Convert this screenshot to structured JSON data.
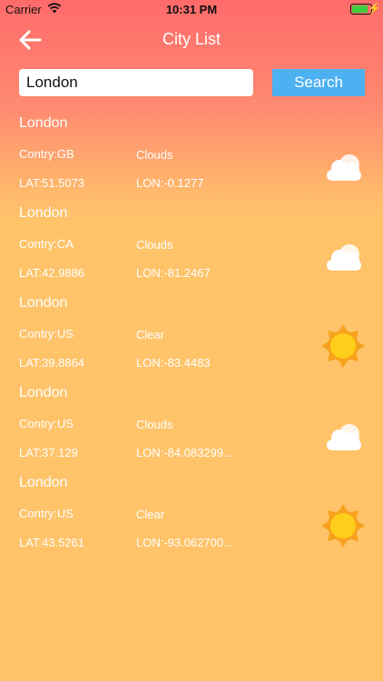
{
  "status_bar": {
    "carrier": "Carrier",
    "time": "10:31 PM",
    "battery_level": 0.9
  },
  "nav": {
    "title": "City List"
  },
  "search": {
    "value": "London",
    "placeholder": "",
    "button_label": "Search"
  },
  "cities": [
    {
      "name": "London",
      "country": "Contry:GB",
      "weather": "Clouds",
      "icon": "cloud-icon",
      "lat": "LAT:51.5073",
      "lon": "LON:-0.1277"
    },
    {
      "name": "London",
      "country": "Contry:CA",
      "weather": "Clouds",
      "icon": "cloud-icon",
      "lat": "LAT:42.9886",
      "lon": "LON:-81.2467"
    },
    {
      "name": "London",
      "country": "Contry:US",
      "weather": "Clear",
      "icon": "sun-icon",
      "lat": "LAT:39.8864",
      "lon": "LON:-83.4483"
    },
    {
      "name": "London",
      "country": "Contry:US",
      "weather": "Clouds",
      "icon": "cloud-icon",
      "lat": "LAT:37.129",
      "lon": "LON:-84.083299..."
    },
    {
      "name": "London",
      "country": "Contry:US",
      "weather": "Clear",
      "icon": "sun-icon",
      "lat": "LAT:43.5261",
      "lon": "LON:-93.062700..."
    }
  ],
  "colors": {
    "gradient_top": "#ff6b6b",
    "gradient_bottom": "#ffc36a",
    "search_button": "#4db0f0",
    "battery": "#3ecf3e",
    "sun": "#ffce1a",
    "sun_rays": "#f7a21d",
    "cloud": "#ffffff"
  }
}
